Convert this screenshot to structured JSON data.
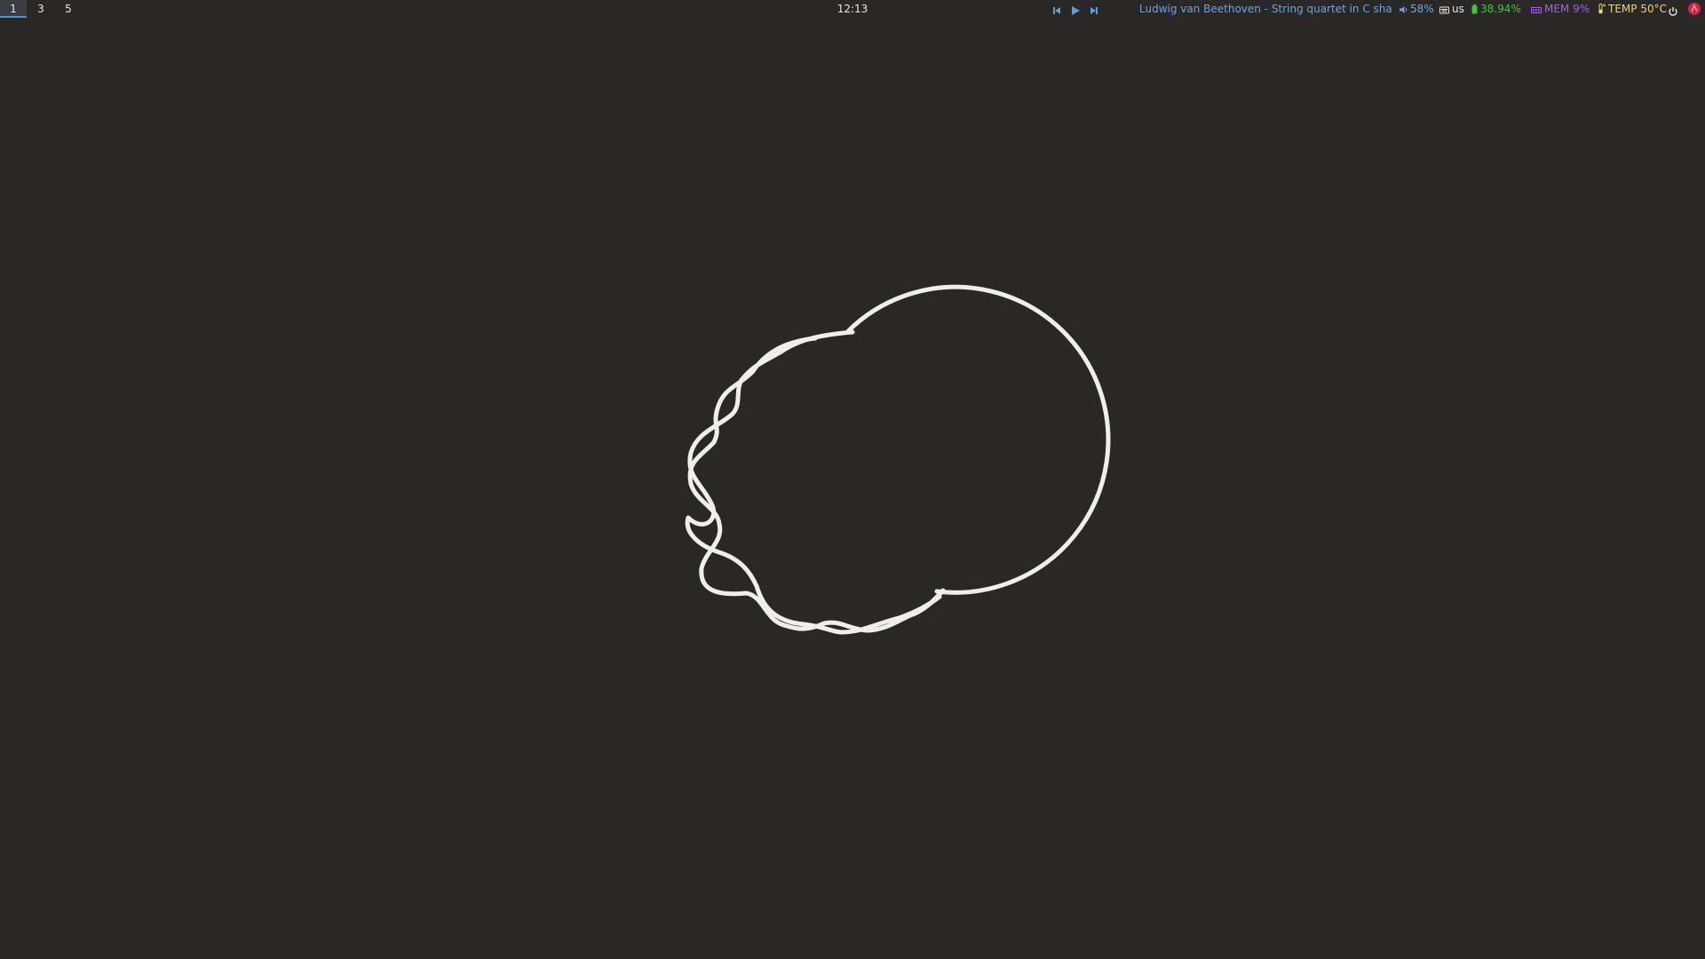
{
  "workspaces": [
    {
      "label": "1",
      "active": true
    },
    {
      "label": "3",
      "active": false
    },
    {
      "label": "5",
      "active": false
    }
  ],
  "clock": "12:13",
  "media": {
    "prev_icon": "skip-previous-icon",
    "play_icon": "play-icon",
    "next_icon": "skip-next-icon",
    "track": "Ludwig van Beethoven - String quartet in C sha...",
    "color": "#6aa4e6"
  },
  "status": {
    "volume": "58%",
    "keyboard_layout": "us",
    "battery": "38.94%",
    "memory": "MEM 9%",
    "temperature": "TEMP 50°C"
  },
  "colors": {
    "background": "#292827",
    "volume": "#6aa4e6",
    "battery": "#3ec43e",
    "memory": "#a064e0",
    "temperature": "#f0d36a",
    "accent": "#4a90d9"
  }
}
